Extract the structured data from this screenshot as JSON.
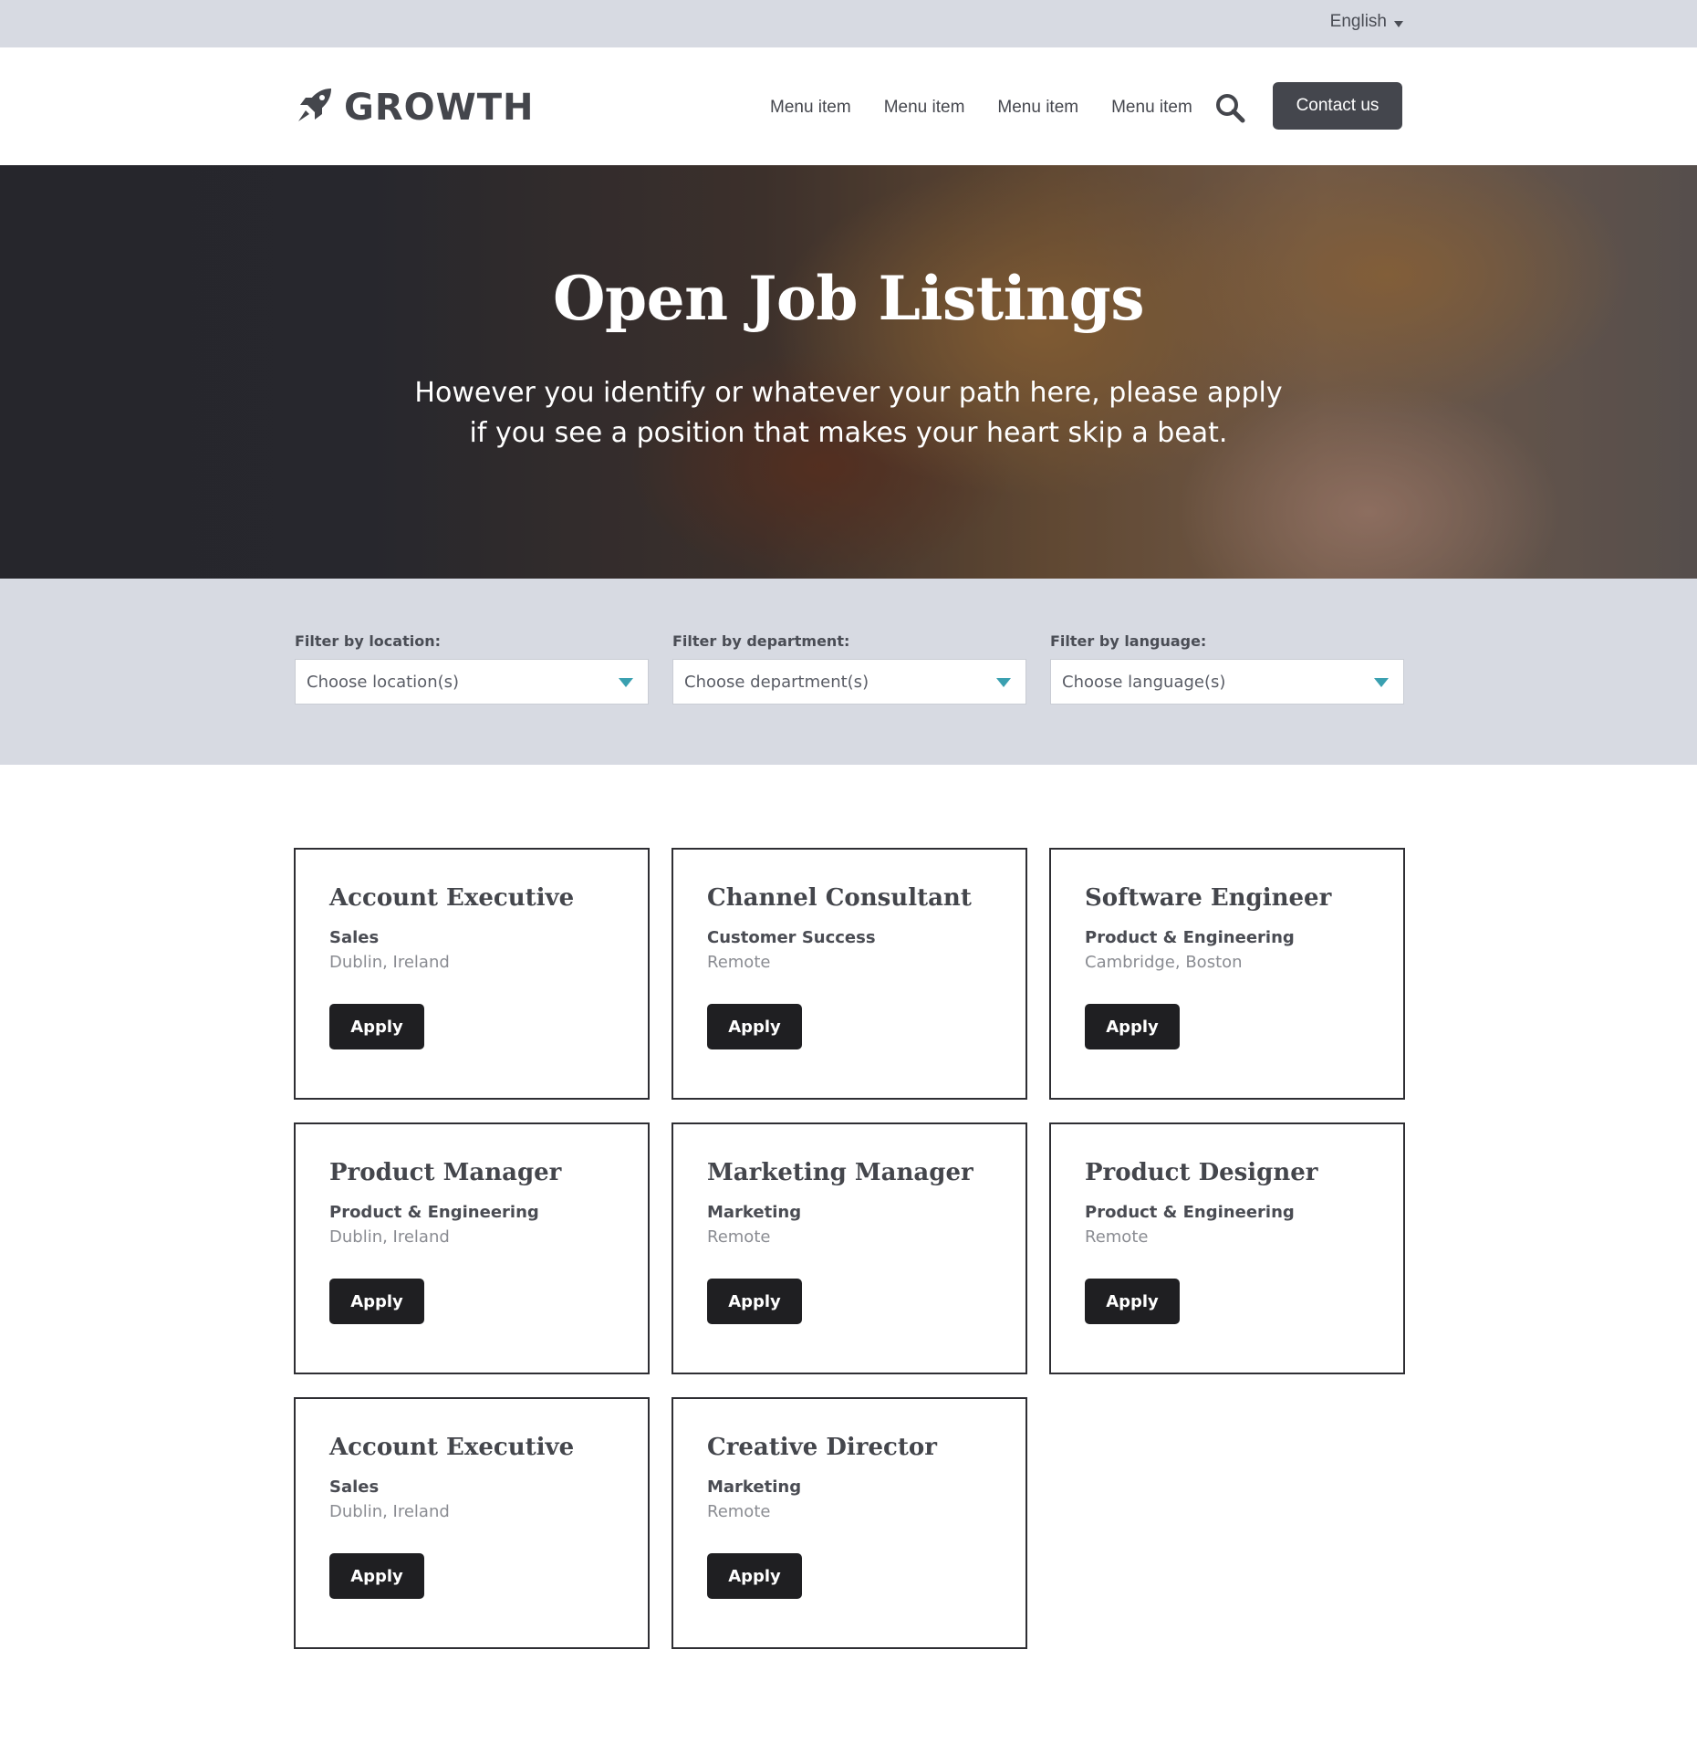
{
  "topbar": {
    "language": "English"
  },
  "header": {
    "logo_text": "GROWTH",
    "nav": [
      "Menu item",
      "Menu item",
      "Menu item",
      "Menu item"
    ],
    "contact_label": "Contact us"
  },
  "hero": {
    "title": "Open Job Listings",
    "subtitle_line1": "However you identify or whatever your path here, please apply",
    "subtitle_line2": "if you see a position that makes your heart skip a beat."
  },
  "filters": [
    {
      "label": "Filter by location:",
      "placeholder": "Choose location(s)"
    },
    {
      "label": "Filter by department:",
      "placeholder": "Choose department(s)"
    },
    {
      "label": "Filter by language:",
      "placeholder": "Choose language(s)"
    }
  ],
  "jobs": [
    {
      "title": "Account Executive",
      "department": "Sales",
      "location": "Dublin, Ireland",
      "apply_label": "Apply"
    },
    {
      "title": "Channel Consultant",
      "department": "Customer Success",
      "location": "Remote",
      "apply_label": "Apply"
    },
    {
      "title": "Software Engineer",
      "department": "Product & Engineering",
      "location": "Cambridge, Boston",
      "apply_label": "Apply"
    },
    {
      "title": "Product Manager",
      "department": "Product & Engineering",
      "location": "Dublin, Ireland",
      "apply_label": "Apply"
    },
    {
      "title": "Marketing Manager",
      "department": "Marketing",
      "location": "Remote",
      "apply_label": "Apply"
    },
    {
      "title": "Product Designer",
      "department": "Product & Engineering",
      "location": "Remote",
      "apply_label": "Apply"
    },
    {
      "title": "Account Executive",
      "department": "Sales",
      "location": "Dublin, Ireland",
      "apply_label": "Apply"
    },
    {
      "title": "Creative Director",
      "department": "Marketing",
      "location": "Remote",
      "apply_label": "Apply"
    }
  ],
  "colors": {
    "accent_arrow": "#3aa0b0",
    "button_dark": "#1f1f22",
    "band": "#d7dae2"
  },
  "icons": {
    "logo": "rocket-icon",
    "search": "search-icon",
    "language_caret": "caret-down-icon",
    "select_arrow": "triangle-down-icon"
  }
}
